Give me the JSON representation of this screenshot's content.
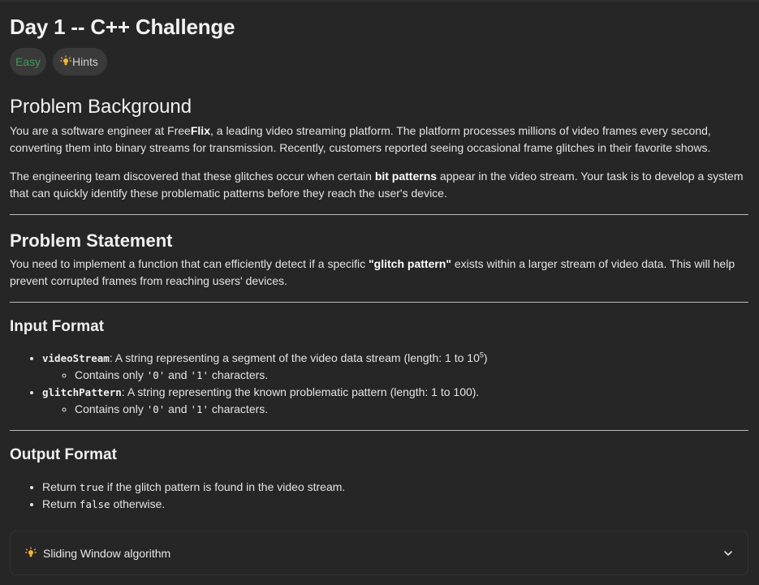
{
  "header": {
    "title": "Day 1 -- C++ Challenge",
    "difficulty": "Easy",
    "hints_label": "Hints"
  },
  "background": {
    "heading": "Problem Background",
    "p1_before": "You are a software engineer at Free",
    "p1_bold": "Flix",
    "p1_after": ", a leading video streaming platform. The platform processes millions of video frames every second, converting them into binary streams for transmission. Recently, customers reported seeing occasional frame glitches in their favorite shows.",
    "p2_before": "The engineering team discovered that these glitches occur when certain ",
    "p2_bold": "bit patterns",
    "p2_after": " appear in the video stream. Your task is to develop a system that can quickly identify these problematic patterns before they reach the user's device."
  },
  "statement": {
    "heading": "Problem Statement",
    "p_before": "You need to implement a function that can efficiently detect if a specific ",
    "p_bold": "\"glitch pattern\"",
    "p_after": " exists within a larger stream of video data. This will help prevent corrupted frames from reaching users' devices."
  },
  "input_format": {
    "heading": "Input Format",
    "item1_code": "videoStream",
    "item1_text": ": A string representing a segment of the video data stream (length: 1 to 10",
    "item1_sup": "5",
    "item1_end": ")",
    "item2_code": "glitchPattern",
    "item2_text": ": A string representing the known problematic pattern (length: 1 to 100).",
    "sub_prefix": "Contains only ",
    "sub_code0": "'0'",
    "sub_and": " and ",
    "sub_code1": "'1'",
    "sub_suffix": " characters."
  },
  "output_format": {
    "heading": "Output Format",
    "item1_prefix": "Return ",
    "item1_code": "true",
    "item1_suffix": " if the glitch pattern is found in the video stream.",
    "item2_prefix": "Return ",
    "item2_code": "false",
    "item2_suffix": " otherwise."
  },
  "hint_accordion": {
    "label": "Sliding Window algorithm"
  },
  "colors": {
    "background": "#262626",
    "easy_green": "#3f9a56",
    "bulb_yellow": "#f2b33d",
    "badge_bg": "#3a3a3a"
  },
  "icons": [
    "lightbulb-icon",
    "chevron-down-icon"
  ]
}
